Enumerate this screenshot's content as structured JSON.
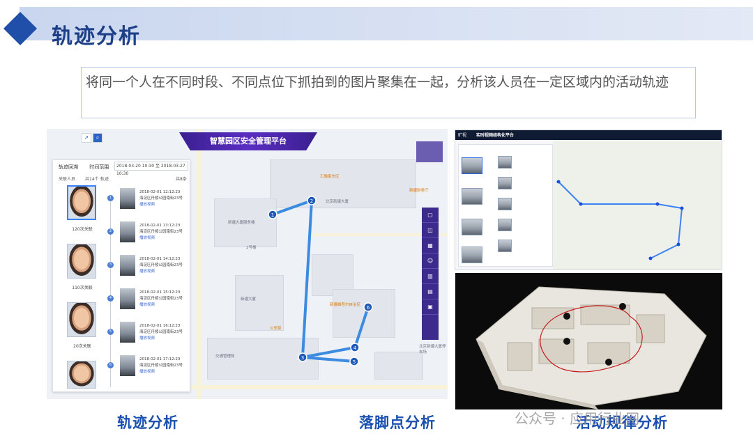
{
  "header": {
    "title": "轨迹分析"
  },
  "description": "将同一个人在不同时段、不同点位下抓拍到的图片聚集在一起，分析该人员在一定区域内的活动轨迹",
  "panel1": {
    "platform_title": "智慧园区安全管理平台",
    "side": {
      "tab": "轨迹回溯",
      "time_label": "时间范围",
      "time_value": "2018-03-20 10:30 至 2018-03-27 10:30",
      "related_label": "关联人员",
      "total": "共14个",
      "track_label": "轨迹",
      "track_count": "共8条",
      "people": [
        {
          "caption": "120次关联"
        },
        {
          "caption": "110次关联"
        },
        {
          "caption": "20次关联"
        },
        {
          "caption": ""
        }
      ],
      "tracks": [
        {
          "num": "1",
          "time": "2018-02-01 12:12:23",
          "addr": "海淀区丹棱公园南街23号",
          "link": "播放视频"
        },
        {
          "num": "2",
          "time": "2018-02-01 13:12:23",
          "addr": "海淀区丹棱公园南街23号",
          "link": "播放视频"
        },
        {
          "num": "3",
          "time": "2018-02-01 14:12:23",
          "addr": "海淀区丹棱公园南街23号",
          "link": "播放视频"
        },
        {
          "num": "4",
          "time": "2018-02-01 15:12:23",
          "addr": "海淀区丹棱公园南街23号",
          "link": "播放视频"
        },
        {
          "num": "5",
          "time": "2018-02-01 16:12:23",
          "addr": "海淀区丹棱公园南街23号",
          "link": "播放视频"
        },
        {
          "num": "6",
          "time": "2018-02-01 17:12:23",
          "addr": "海淀区丹棱公园南街23号",
          "link": "播放视频"
        }
      ]
    },
    "route_points": [
      "1",
      "2",
      "3",
      "4",
      "5",
      "6"
    ],
    "map_labels": [
      "汇融家东区",
      "北京新疆大厦",
      "新疆大厦服务楼",
      "新疆财务厅",
      "新疆维吾尔自治区",
      "新疆大厦",
      "2号楼",
      "公安部",
      "交通管理局",
      "北京新疆大厦停车场"
    ],
    "search_icon": "search-icon",
    "locate_icon": "locate-icon"
  },
  "panel2": {
    "title": "实时视频结构化平台",
    "brand": "旷视",
    "colors": {
      "route": "#3b82f6"
    }
  },
  "captions": {
    "c1": "轨迹分析",
    "c2": "落脚点分析",
    "c3": "活动规律分析"
  },
  "watermark": "公众号 · 应用行业网",
  "colors": {
    "accent": "#1f4fa8",
    "route": "#3b8be0",
    "title": "#1c3f87"
  }
}
